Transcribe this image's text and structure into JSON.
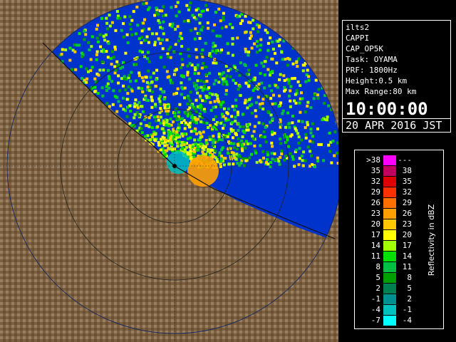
{
  "info": {
    "lines": [
      "ilts2",
      "CAPPI",
      "CAP_OP5K",
      "Task: OYAMA",
      "PRF: 1800Hz",
      "Height:0.5 km",
      "Max Range:80 km"
    ],
    "time": "10:00:00",
    "date": "20 APR 2016 JST"
  },
  "legend": {
    "title": "Reflectivity in dBZ",
    "rows": [
      {
        "low": ">38",
        "high": "---",
        "color": "#ff00ff"
      },
      {
        "low": "35",
        "high": "38",
        "color": "#c00060"
      },
      {
        "low": "32",
        "high": "35",
        "color": "#e00000"
      },
      {
        "low": "29",
        "high": "32",
        "color": "#ff3000"
      },
      {
        "low": "26",
        "high": "29",
        "color": "#ff7000"
      },
      {
        "low": "23",
        "high": "26",
        "color": "#ffa000"
      },
      {
        "low": "20",
        "high": "23",
        "color": "#ffc800"
      },
      {
        "low": "17",
        "high": "20",
        "color": "#ffff00"
      },
      {
        "low": "14",
        "high": "17",
        "color": "#a0ff00"
      },
      {
        "low": "11",
        "high": "14",
        "color": "#00e000"
      },
      {
        "low": "8",
        "high": "11",
        "color": "#00c040"
      },
      {
        "low": "5",
        "high": "8",
        "color": "#00a000"
      },
      {
        "low": "2",
        "high": "5",
        "color": "#008050"
      },
      {
        "low": "-1",
        "high": "2",
        "color": "#009090"
      },
      {
        "low": "-4",
        "high": "-1",
        "color": "#00c0c0"
      },
      {
        "low": "-7",
        "high": "-4",
        "color": "#00ffff"
      }
    ]
  },
  "map": {
    "sea_color": "#0033cc",
    "land_color": "#8a7050",
    "range_km": 80
  }
}
